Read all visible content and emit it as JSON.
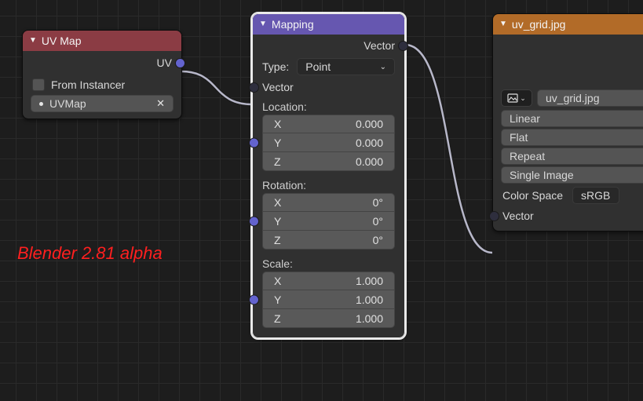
{
  "overlay": {
    "text": "Blender 2.81 alpha"
  },
  "nodes": {
    "uvmap": {
      "title": "UV Map",
      "outputs": {
        "uv": "UV"
      },
      "props": {
        "from_instancer": "From Instancer",
        "map_name": "UVMap"
      }
    },
    "mapping": {
      "title": "Mapping",
      "outputs": {
        "vector": "Vector"
      },
      "type_label": "Type:",
      "type_value": "Point",
      "inputs": {
        "vector": "Vector"
      },
      "location": {
        "label": "Location:",
        "x": {
          "a": "X",
          "v": "0.000"
        },
        "y": {
          "a": "Y",
          "v": "0.000"
        },
        "z": {
          "a": "Z",
          "v": "0.000"
        }
      },
      "rotation": {
        "label": "Rotation:",
        "x": {
          "a": "X",
          "v": "0°"
        },
        "y": {
          "a": "Y",
          "v": "0°"
        },
        "z": {
          "a": "Z",
          "v": "0°"
        }
      },
      "scale": {
        "label": "Scale:",
        "x": {
          "a": "X",
          "v": "1.000"
        },
        "y": {
          "a": "Y",
          "v": "1.000"
        },
        "z": {
          "a": "Z",
          "v": "1.000"
        }
      }
    },
    "img": {
      "title": "uv_grid.jpg",
      "file": "uv_grid.jpg",
      "interp": "Linear",
      "proj": "Flat",
      "ext": "Repeat",
      "source": "Single Image",
      "cs_label": "Color Space",
      "cs_value": "sRGB",
      "inputs": {
        "vector": "Vector"
      }
    }
  }
}
